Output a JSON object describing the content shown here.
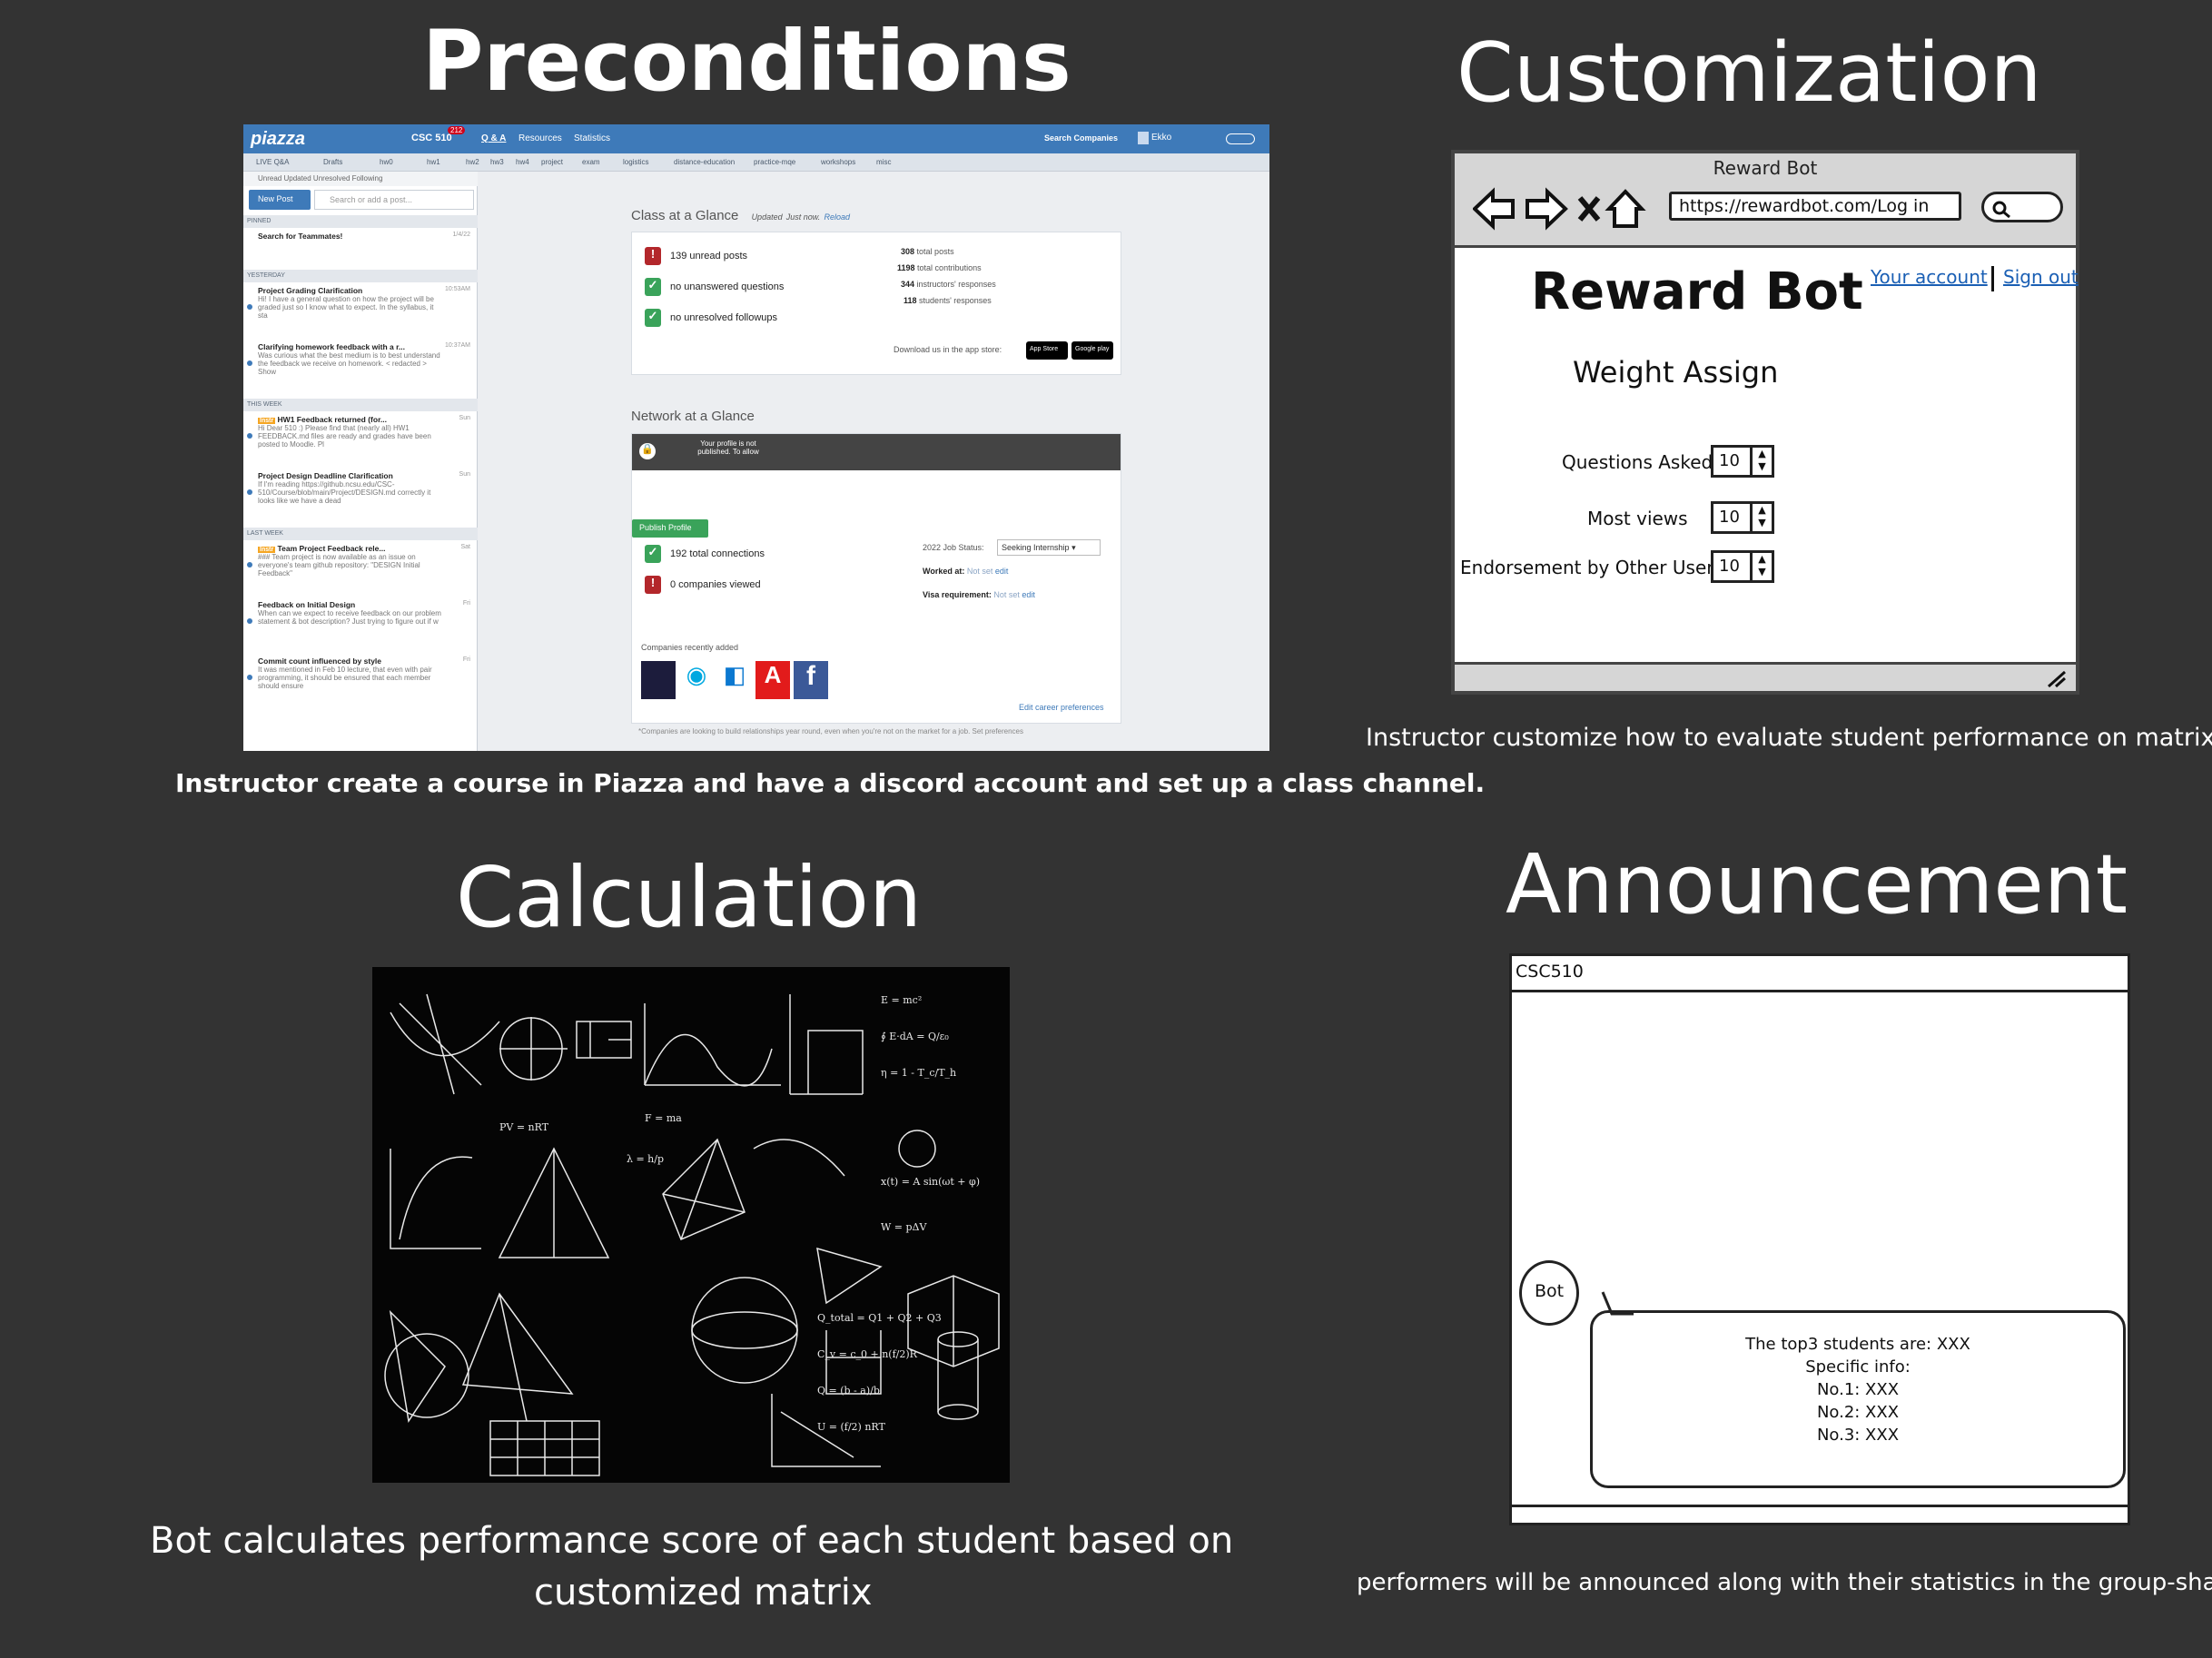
{
  "sections": {
    "preconditions": {
      "title": "Preconditions",
      "caption": "Instructor create a course in Piazza and have a discord account and set up a class channel."
    },
    "customization": {
      "title": "Customization",
      "caption": "Instructor customize how to evaluate student performance on matrix"
    },
    "calculation": {
      "title": "Calculation",
      "caption_line1": "Bot calculates performance score of each student based on",
      "caption_line2": "customized matrix"
    },
    "announcement": {
      "title": "Announcement",
      "caption": "performers will be announced along with their statistics in the group-sha"
    }
  },
  "piazza": {
    "logo": "piazza",
    "course": "CSC 510",
    "unread_badge": "212",
    "nav": [
      "Q & A",
      "Resources",
      "Statistics"
    ],
    "search_companies": "Search Companies",
    "user_name": "Ekko",
    "folders": [
      "LIVE Q&A",
      "Drafts",
      "hw0",
      "hw1",
      "hw2",
      "hw3",
      "hw4",
      "project",
      "exam",
      "logistics",
      "distance-education",
      "practice-mqe",
      "workshops",
      "misc"
    ],
    "filters": "Unread   Updated   Unresolved   Following",
    "new_post": "New Post",
    "search_placeholder": "Search or add a post...",
    "sections": {
      "pinned": "PINNED",
      "yesterday": "YESTERDAY",
      "this_week": "THIS WEEK",
      "last_week": "LAST WEEK"
    },
    "posts": [
      {
        "title": "Search for Teammates!",
        "snippet": "",
        "date": "1/4/22"
      },
      {
        "title": "Project Grading Clarification",
        "snippet": "Hi! I have a general question on how the project will be graded just so I know what to expect. In the syllabus, it sta",
        "date": "10:53AM"
      },
      {
        "title": "Clarifying homework feedback with a r...",
        "snippet": "Was curious what the best medium is to best understand the feedback we receive on homework. < redacted > Show",
        "date": "10:37AM"
      },
      {
        "title": "HW1 Feedback returned (for...",
        "snippet": "Hi Dear 510 :) Please find that (nearly all) HW1 FEEDBACK.md files are ready and grades have been posted to Moodle. Pl",
        "date": "Sun"
      },
      {
        "title": "Project Design Deadline Clarification",
        "snippet": "If I'm reading https://github.ncsu.edu/CSC-510/Course/blob/main/Project/DESIGN.md correctly it looks like we have a dead",
        "date": "Sun"
      },
      {
        "title": "Team Project Feedback rele...",
        "snippet": "### Team project is now available as an issue on everyone's team github repository: \"DESIGN Initial Feedback\"",
        "date": "Sat"
      },
      {
        "title": "Feedback on Initial Design",
        "snippet": "When can we expect to receive feedback on our problem statement & bot description? Just trying to figure out if w",
        "date": "Fri"
      },
      {
        "title": "Commit count influenced by style",
        "snippet": "It was mentioned in Feb 10 lecture, that even with pair programming, it should be ensured that each member should ensure",
        "date": "Fri"
      }
    ],
    "instr_tag": "Instr",
    "class_glance": {
      "heading": "Class at a Glance",
      "updated": "Updated",
      "just_now": "Just now.",
      "reload": "Reload",
      "items": [
        "139 unread posts",
        "no unanswered questions",
        "no unresolved followups"
      ],
      "stats": [
        {
          "num": "308",
          "label": "total posts"
        },
        {
          "num": "1198",
          "label": "total contributions"
        },
        {
          "num": "344",
          "label": "instructors' responses"
        },
        {
          "num": "118",
          "label": "students' responses"
        }
      ],
      "download": "Download us in the app store:",
      "app_store": "App Store",
      "google_play": "Google play"
    },
    "network_glance": {
      "heading": "Network at a Glance",
      "profile_notice": "Your profile is not published. To allow",
      "publish": "Publish Profile",
      "connections": "192 total connections",
      "companies_viewed": "0 companies viewed",
      "job_status_label": "2022 Job Status:",
      "job_status_value": "Seeking Internship",
      "worked_at_label": "Worked at:",
      "worked_at_value": "Not set",
      "visa_label": "Visa requirement:",
      "visa_value": "Not set",
      "edit": "edit",
      "recent_label": "Companies recently added",
      "edit_career": "Edit career preferences",
      "footnote": "*Companies are looking to build relationships year round, even when you're not on the market for a job. Set preferences"
    }
  },
  "reward_bot": {
    "window_title": "Reward Bot",
    "url": "https://rewardbot.com/Log in",
    "heading": "Reward Bot",
    "subheading": "Weight Assign",
    "your_account": "Your account",
    "sign_out": "Sign out",
    "fields": [
      {
        "label": "Questions Asked",
        "value": "10"
      },
      {
        "label": "Most views",
        "value": "10"
      },
      {
        "label": "Endorsement by Other Users",
        "value": "10"
      }
    ]
  },
  "announcement": {
    "channel": "CSC510",
    "bot_label": "Bot",
    "message": [
      "The top3 students are: XXX",
      "Specific info:",
      "No.1: XXX",
      "No.2: XXX",
      "No.3: XXX"
    ]
  },
  "blackboard": {
    "formulas": [
      "Q_total = Q1 + Q2 + Q3",
      "C_v = c_0 + n(f/2)R",
      "Q = (b - a)/b",
      "U = (f/2) nRT",
      "η = 1 - T_c/T_h",
      "W = pΔV",
      "E = mc²",
      "∮ E·dA = Q/ε₀",
      "F = ma",
      "x(t) = A sin(ωt + φ)",
      "λ = h/p",
      "PV = nRT"
    ]
  },
  "colors": {
    "background": "#333333",
    "piazza_blue": "#3e7ab9",
    "alert_red": "#b3272b",
    "ok_green": "#3aa35a",
    "link_blue": "#1a5fb4"
  }
}
